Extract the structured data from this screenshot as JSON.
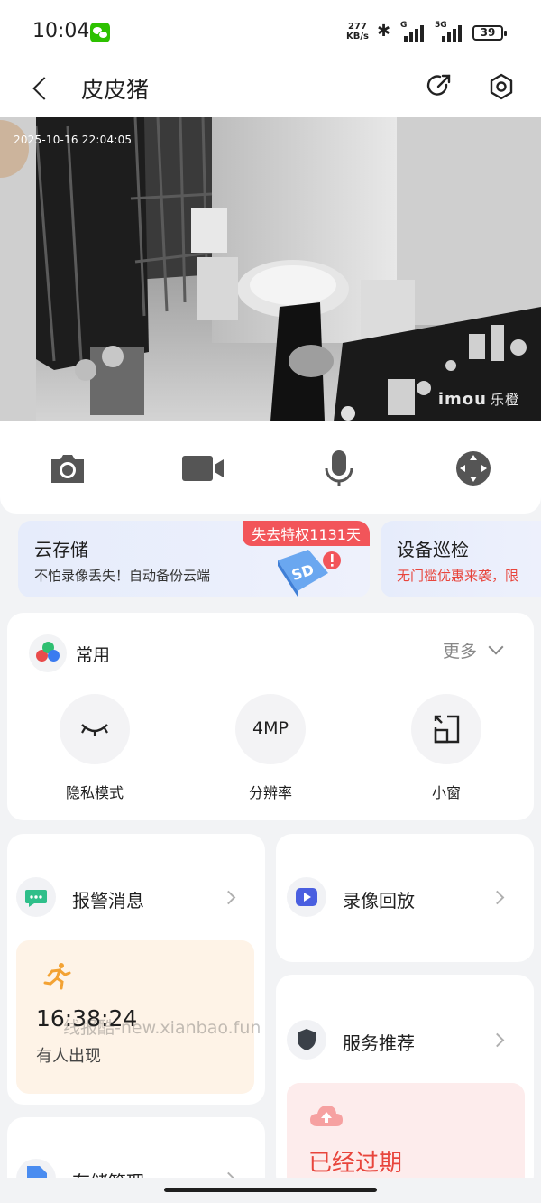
{
  "status_bar": {
    "time": "10:04",
    "net_speed_value": "277",
    "net_speed_unit": "KB/s",
    "signal1_label": "G",
    "signal2_label": "5G",
    "battery": "39"
  },
  "header": {
    "title": "皮皮猪"
  },
  "video": {
    "timestamp": "2025-10-16 22:04:05",
    "brand": "imou",
    "brand_cn": "乐橙"
  },
  "promos": [
    {
      "title": "云存储",
      "subtitle": "不怕录像丢失！自动备份云端",
      "tag": "失去特权1131天"
    },
    {
      "title": "设备巡检",
      "subtitle": "无门槛优惠来袭，限"
    }
  ],
  "common": {
    "label": "常用",
    "more": "更多",
    "items": [
      {
        "label": "隐私模式",
        "icon": "closed-eye-icon"
      },
      {
        "label": "分辨率",
        "value": "4MP"
      },
      {
        "label": "小窗",
        "icon": "mini-window-icon"
      }
    ]
  },
  "alarm_card": {
    "label": "报警消息",
    "time": "16:38:24",
    "desc": "有人出现"
  },
  "playback_card": {
    "label": "录像回放"
  },
  "service_card": {
    "label": "服务推荐",
    "expired": "已经过期"
  },
  "storage_card": {
    "label": "存储管理"
  },
  "watermark": "线报酷-new.xianbao.fun"
}
